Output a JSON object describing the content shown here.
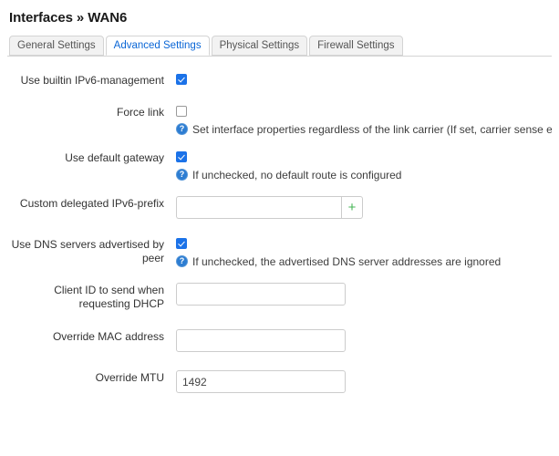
{
  "header": {
    "title": "Interfaces » WAN6"
  },
  "tabs": [
    {
      "label": "General Settings",
      "active": false
    },
    {
      "label": "Advanced Settings",
      "active": true
    },
    {
      "label": "Physical Settings",
      "active": false
    },
    {
      "label": "Firewall Settings",
      "active": false
    }
  ],
  "icons": {
    "help": "?",
    "add": "+"
  },
  "colors": {
    "accent_blue": "#0a66d6",
    "checkbox_on": "#1b72e8",
    "help_icon": "#2d7dd2",
    "add_green": "#44b555",
    "tab_inactive_bg": "#f2f2f2",
    "border": "#d4d4d4"
  },
  "form": {
    "use_builtin_ipv6": {
      "label": "Use builtin IPv6-management",
      "checked": true
    },
    "force_link": {
      "label": "Force link",
      "checked": false,
      "help": "Set interface properties regardless of the link carrier (If set, carrier sense events"
    },
    "use_default_gateway": {
      "label": "Use default gateway",
      "checked": true,
      "help": "If unchecked, no default route is configured"
    },
    "custom_delegated_prefix": {
      "label": "Custom delegated IPv6-prefix",
      "value": "",
      "placeholder": ""
    },
    "use_dns_advertised": {
      "label": "Use DNS servers advertised by peer",
      "checked": true,
      "help": "If unchecked, the advertised DNS server addresses are ignored"
    },
    "client_id_dhcp": {
      "label": "Client ID to send when requesting DHCP",
      "value": "",
      "placeholder": ""
    },
    "override_mac": {
      "label": "Override MAC address",
      "value": "",
      "placeholder": ""
    },
    "override_mtu": {
      "label": "Override MTU",
      "value": "1492",
      "placeholder": ""
    }
  }
}
